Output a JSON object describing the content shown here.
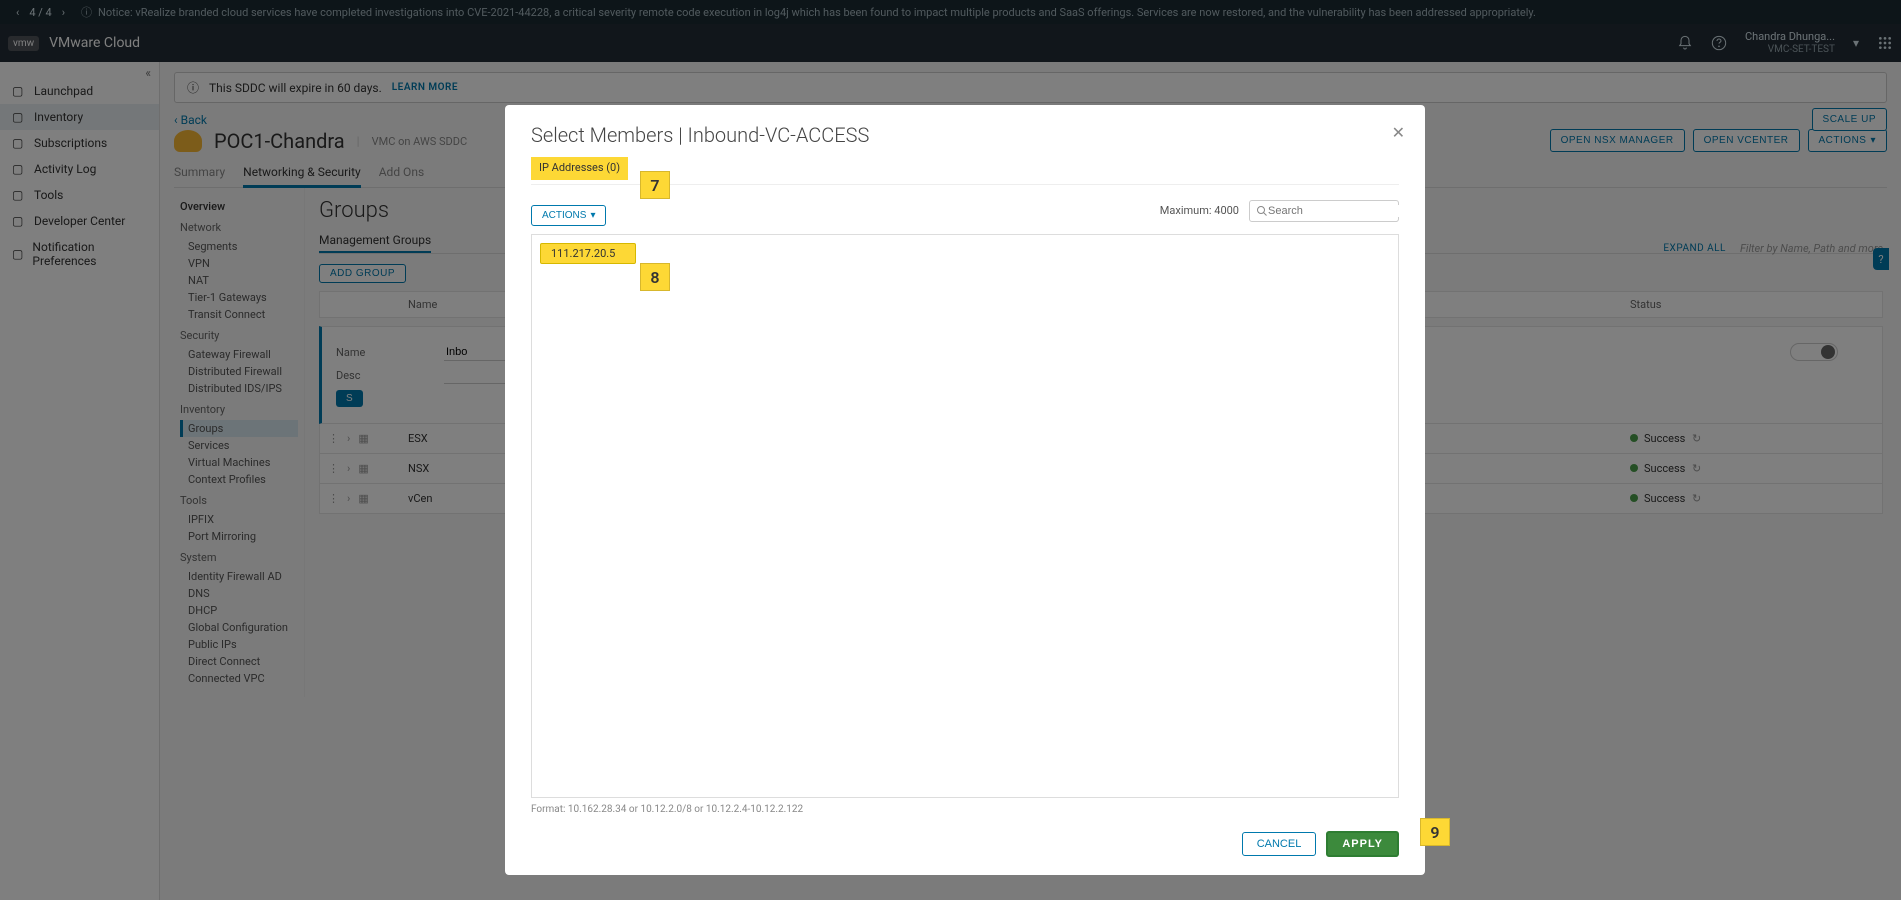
{
  "notice": {
    "pager": "4 / 4",
    "text": "Notice: vRealize branded cloud services have completed investigations into CVE-2021-44228, a critical severity remote code execution in log4j which has been found to impact multiple products and SaaS offerings. Services are now restored, and the vulnerability has been addressed appropriately."
  },
  "brand": {
    "logo": "vmw",
    "product": "VMware Cloud"
  },
  "user": {
    "name": "Chandra Dhunga...",
    "org": "VMC-SET-TEST"
  },
  "sidebar": {
    "items": [
      {
        "icon": "launchpad-icon",
        "label": "Launchpad"
      },
      {
        "icon": "inventory-icon",
        "label": "Inventory",
        "active": true
      },
      {
        "icon": "subscriptions-icon",
        "label": "Subscriptions"
      },
      {
        "icon": "activity-icon",
        "label": "Activity Log"
      },
      {
        "icon": "tools-icon",
        "label": "Tools"
      },
      {
        "icon": "devcenter-icon",
        "label": "Developer Center"
      },
      {
        "icon": "notifprefs-icon",
        "label": "Notification Preferences"
      }
    ]
  },
  "banner": {
    "text": "This SDDC will expire in 60 days.",
    "learn_more": "LEARN MORE"
  },
  "back": "Back",
  "sddc": {
    "title": "POC1-Chandra",
    "meta": "VMC on AWS SDDC"
  },
  "top_buttons": {
    "nsx": "OPEN NSX MANAGER",
    "vcenter": "OPEN VCENTER",
    "actions": "ACTIONS",
    "scale": "SCALE UP"
  },
  "tabs": [
    "Summary",
    "Networking & Security",
    "Add Ons"
  ],
  "tree": {
    "overview": "Overview",
    "sections": [
      {
        "heading": "Network",
        "items": [
          "Segments",
          "VPN",
          "NAT",
          "Tier-1 Gateways",
          "Transit Connect"
        ]
      },
      {
        "heading": "Security",
        "items": [
          "Gateway Firewall",
          "Distributed Firewall",
          "Distributed IDS/IPS"
        ]
      },
      {
        "heading": "Inventory",
        "items": [
          "Groups",
          "Services",
          "Virtual Machines",
          "Context Profiles"
        ],
        "active": "Groups"
      },
      {
        "heading": "Tools",
        "items": [
          "IPFIX",
          "Port Mirroring"
        ]
      },
      {
        "heading": "System",
        "items": [
          "Identity Firewall AD",
          "DNS",
          "DHCP",
          "Global Configuration",
          "Public IPs",
          "Direct Connect",
          "Connected VPC"
        ]
      }
    ]
  },
  "groups": {
    "title": "Groups",
    "subtabs": [
      "Management Groups"
    ],
    "add_group": "ADD GROUP",
    "expand_all": "EXPAND ALL",
    "filter_placeholder": "Filter by Name, Path and more",
    "columns": {
      "name": "Name",
      "status": "Status"
    },
    "detail": {
      "name_label": "Name",
      "name_value": "Inbo",
      "desc_label": "Desc",
      "set": "S"
    },
    "rows": [
      {
        "name": "ESX",
        "status": "Success"
      },
      {
        "name": "NSX",
        "status": "Success"
      },
      {
        "name": "vCen",
        "status": "Success"
      }
    ]
  },
  "modal": {
    "title": "Select Members | Inbound-VC-ACCESS",
    "ip_tab": "IP Addresses (0)",
    "actions": "ACTIONS",
    "maximum": "Maximum: 4000",
    "search_placeholder": "Search",
    "ip_value": "111.217.20.5",
    "format_hint": "Format: 10.162.28.34 or 10.12.2.0/8 or 10.12.2.4-10.12.2.122",
    "cancel": "CANCEL",
    "apply": "APPLY"
  },
  "callouts": {
    "c7": "7",
    "c8": "8",
    "c9": "9"
  }
}
